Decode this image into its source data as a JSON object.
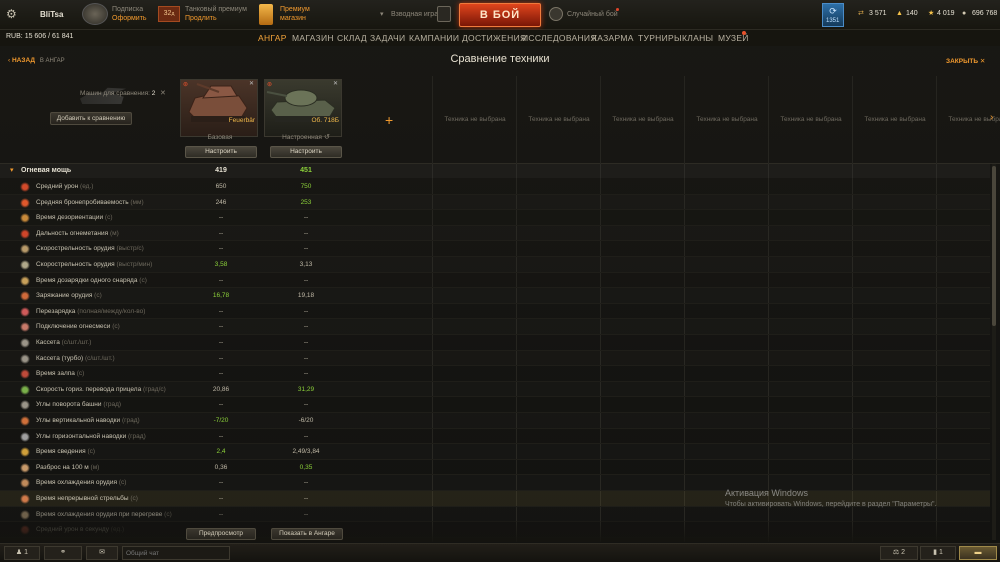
{
  "top": {
    "player": "BliTsa",
    "subscription_title": "Подписка",
    "subscription_action": "Оформить",
    "premium_days": "32",
    "premium_days_unit": "д",
    "premium_title": "Танковый премиум",
    "premium_action": "Продлить",
    "shop_title": "Премиум",
    "shop_subtitle": "магазин",
    "platoon": "Взводная игра",
    "battle_button": "В БОЙ",
    "battle_mode": "Случайный бой",
    "badge_count": "1351",
    "credits_bonds": "3 571",
    "gold": "140",
    "free_xp": "4 019",
    "silver": "696 768"
  },
  "nav": {
    "rub_label": "RUB:",
    "rub_value": "15 606",
    "rub_sep": "/",
    "rub_total": "61 841",
    "items": [
      "АНГАР",
      "МАГАЗИН",
      "СКЛАД",
      "ЗАДАЧИ",
      "КАМПАНИИ",
      "ДОСТИЖЕНИЯ",
      "ИССЛЕДОВАНИЯ",
      "КАЗАРМА",
      "ТУРНИРЫ",
      "КЛАНЫ",
      "МУЗЕЙ"
    ]
  },
  "title": {
    "back": "НАЗАД",
    "back_sub": "В АНГАР",
    "page_title": "Сравнение техники",
    "close": "ЗАКРЫТЬ"
  },
  "compare": {
    "count_label": "Машин для сравнения:",
    "count": "2",
    "add_button": "Добавить к сравнению",
    "empty_slot": "Техника не выбрана",
    "vehicles": [
      {
        "name": "Feuerbär",
        "config": "Базовая",
        "button": "Настроить"
      },
      {
        "name": "Об. 718Б",
        "config": "Настроенная",
        "button": "Настроить"
      }
    ]
  },
  "section": {
    "title": "Огневая мощь",
    "v1": "419",
    "v2": "451"
  },
  "rows": [
    {
      "label": "Средний урон",
      "unit": "(ед.)",
      "v1": "650",
      "v2": "750",
      "g1": false,
      "g2": true
    },
    {
      "label": "Средняя бронепробиваемость",
      "unit": "(мм)",
      "v1": "246",
      "v2": "253",
      "g1": false,
      "g2": true
    },
    {
      "label": "Время дезориентации",
      "unit": "(с)",
      "v1": "--",
      "v2": "--",
      "g1": false,
      "g2": false
    },
    {
      "label": "Дальность огнеметания",
      "unit": "(м)",
      "v1": "--",
      "v2": "--",
      "g1": false,
      "g2": false
    },
    {
      "label": "Скорострельность орудия",
      "unit": "(выстр/с)",
      "v1": "--",
      "v2": "--",
      "g1": false,
      "g2": false
    },
    {
      "label": "Скорострельность орудия",
      "unit": "(выстр/мин)",
      "v1": "3,58",
      "v2": "3,13",
      "g1": true,
      "g2": false
    },
    {
      "label": "Время дозарядки одного снаряда",
      "unit": "(с)",
      "v1": "--",
      "v2": "--",
      "g1": false,
      "g2": false
    },
    {
      "label": "Заряжание орудия",
      "unit": "(с)",
      "v1": "16,78",
      "v2": "19,18",
      "g1": true,
      "g2": false
    },
    {
      "label": "Перезарядка",
      "unit": "(полная/между/кол-во)",
      "v1": "--",
      "v2": "--",
      "g1": false,
      "g2": false
    },
    {
      "label": "Подключение огнесмеси",
      "unit": "(с)",
      "v1": "--",
      "v2": "--",
      "g1": false,
      "g2": false
    },
    {
      "label": "Кассета",
      "unit": "(с/шт./шт.)",
      "v1": "--",
      "v2": "--",
      "g1": false,
      "g2": false
    },
    {
      "label": "Кассета (турбо)",
      "unit": "(с/шт./шт.)",
      "v1": "--",
      "v2": "--",
      "g1": false,
      "g2": false
    },
    {
      "label": "Время залпа",
      "unit": "(с)",
      "v1": "--",
      "v2": "--",
      "g1": false,
      "g2": false
    },
    {
      "label": "Скорость гориз. перевода прицела",
      "unit": "(град/с)",
      "v1": "20,86",
      "v2": "31,29",
      "g1": false,
      "g2": true
    },
    {
      "label": "Углы поворота башни",
      "unit": "(град)",
      "v1": "--",
      "v2": "--",
      "g1": false,
      "g2": false
    },
    {
      "label": "Углы вертикальной наводки",
      "unit": "(град)",
      "v1": "-7/20",
      "v2": "-6/20",
      "g1": true,
      "g2": false
    },
    {
      "label": "Углы горизонтальной наводки",
      "unit": "(град)",
      "v1": "--",
      "v2": "--",
      "g1": false,
      "g2": false
    },
    {
      "label": "Время сведения",
      "unit": "(с)",
      "v1": "2,4",
      "v2": "2,49/3,84",
      "g1": true,
      "g2": false
    },
    {
      "label": "Разброс на 100 м",
      "unit": "(м)",
      "v1": "0,36",
      "v2": "0,35",
      "g1": false,
      "g2": true
    },
    {
      "label": "Время охлаждения орудия",
      "unit": "(с)",
      "v1": "--",
      "v2": "--",
      "g1": false,
      "g2": false
    },
    {
      "label": "Время непрерывной стрельбы",
      "unit": "(с)",
      "v1": "--",
      "v2": "--",
      "g1": false,
      "g2": false
    },
    {
      "label": "Время охлаждения орудия при перегреве",
      "unit": "(с)",
      "v1": "--",
      "v2": "--",
      "g1": false,
      "g2": false
    },
    {
      "label": "Средний урон в секунду",
      "unit": "(ед.)",
      "v1": "--",
      "v2": "--",
      "g1": false,
      "g2": false
    }
  ],
  "footer_buttons": {
    "preview": "Предпросмотр",
    "show_hangar": "Показать в Ангаре"
  },
  "bottom": {
    "players": "1",
    "chat_placeholder": "Общий чат",
    "scales": "2",
    "stats": "1"
  },
  "watermark": {
    "title": "Активация Windows",
    "text": "Чтобы активировать Windows, перейдите в раздел \"Параметры\"."
  }
}
